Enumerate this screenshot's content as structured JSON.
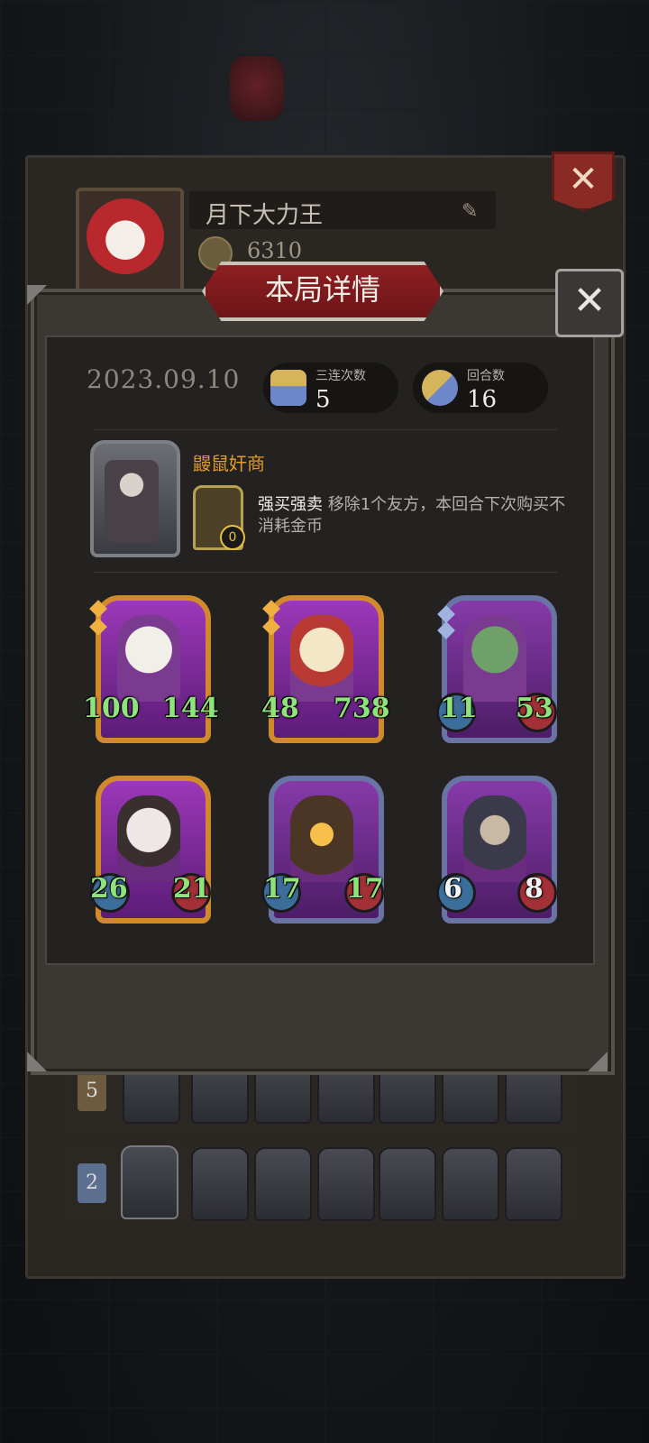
{
  "profile": {
    "player_name": "月下大力王",
    "gold": "6310"
  },
  "modal": {
    "title": "本局详情",
    "date": "2023.09.10",
    "stats": [
      {
        "label": "三连次数",
        "value": "5",
        "icon": "triple-icon"
      },
      {
        "label": "回合数",
        "value": "16",
        "icon": "rounds-icon"
      }
    ],
    "hero": {
      "name": "鼹鼠奸商",
      "skill_name": "强买强卖",
      "skill_desc": "移除1个友方，本回合下次购买不消耗金币",
      "skill_counter": "0"
    },
    "cards": [
      {
        "attack": "100",
        "health": "144",
        "frame": "gold"
      },
      {
        "attack": "48",
        "health": "738",
        "frame": "gold"
      },
      {
        "attack": "11",
        "health": "53",
        "frame": "blue"
      },
      {
        "attack": "26",
        "health": "21",
        "frame": "gold"
      },
      {
        "attack": "17",
        "health": "17",
        "frame": "blue"
      },
      {
        "attack": "6",
        "health": "8",
        "frame": "blue"
      }
    ]
  },
  "history_rows": [
    {
      "rank": "5"
    },
    {
      "rank": "2"
    }
  ]
}
